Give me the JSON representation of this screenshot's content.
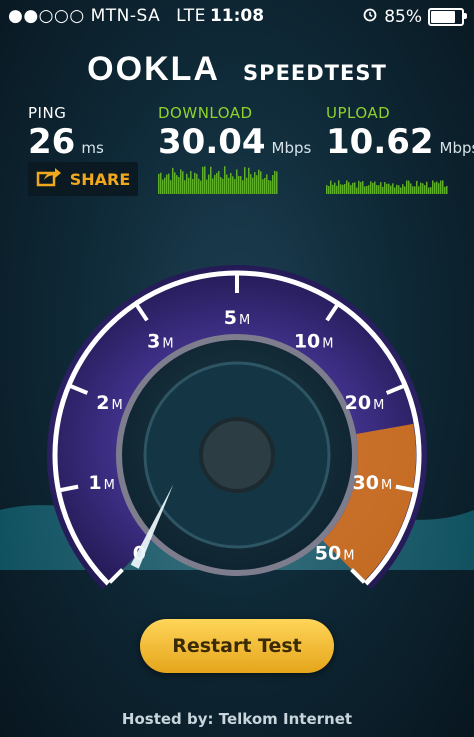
{
  "status_bar": {
    "signal_dots": "●●○○○",
    "carrier": "MTN-SA",
    "network": "LTE",
    "time": "11:08",
    "battery_text": "85%",
    "battery_level": 0.85
  },
  "brand": {
    "logo": "OOKLA",
    "title": "SPEEDTEST"
  },
  "ping": {
    "label": "PING",
    "value": "26",
    "unit": "ms"
  },
  "download": {
    "label": "DOWNLOAD",
    "value": "30.04",
    "unit": "Mbps"
  },
  "upload": {
    "label": "UPLOAD",
    "value": "10.62",
    "unit": "Mbps"
  },
  "share": {
    "label": "SHARE",
    "icon": "share-icon"
  },
  "gauge": {
    "ticks": [
      {
        "num": "0",
        "unit": ""
      },
      {
        "num": "1",
        "unit": "M"
      },
      {
        "num": "2",
        "unit": "M"
      },
      {
        "num": "3",
        "unit": "M"
      },
      {
        "num": "5",
        "unit": "M"
      },
      {
        "num": "10",
        "unit": "M"
      },
      {
        "num": "20",
        "unit": "M"
      },
      {
        "num": "30",
        "unit": "M"
      },
      {
        "num": "50",
        "unit": "M"
      }
    ],
    "needle_value": 0.6
  },
  "restart": {
    "label": "Restart Test"
  },
  "hosted": {
    "text": "Hosted by: Telkom Internet"
  },
  "colors": {
    "accent_green": "#8fd22a",
    "accent_orange": "#f2a81c",
    "gauge_purple": "#6a4fc2"
  }
}
